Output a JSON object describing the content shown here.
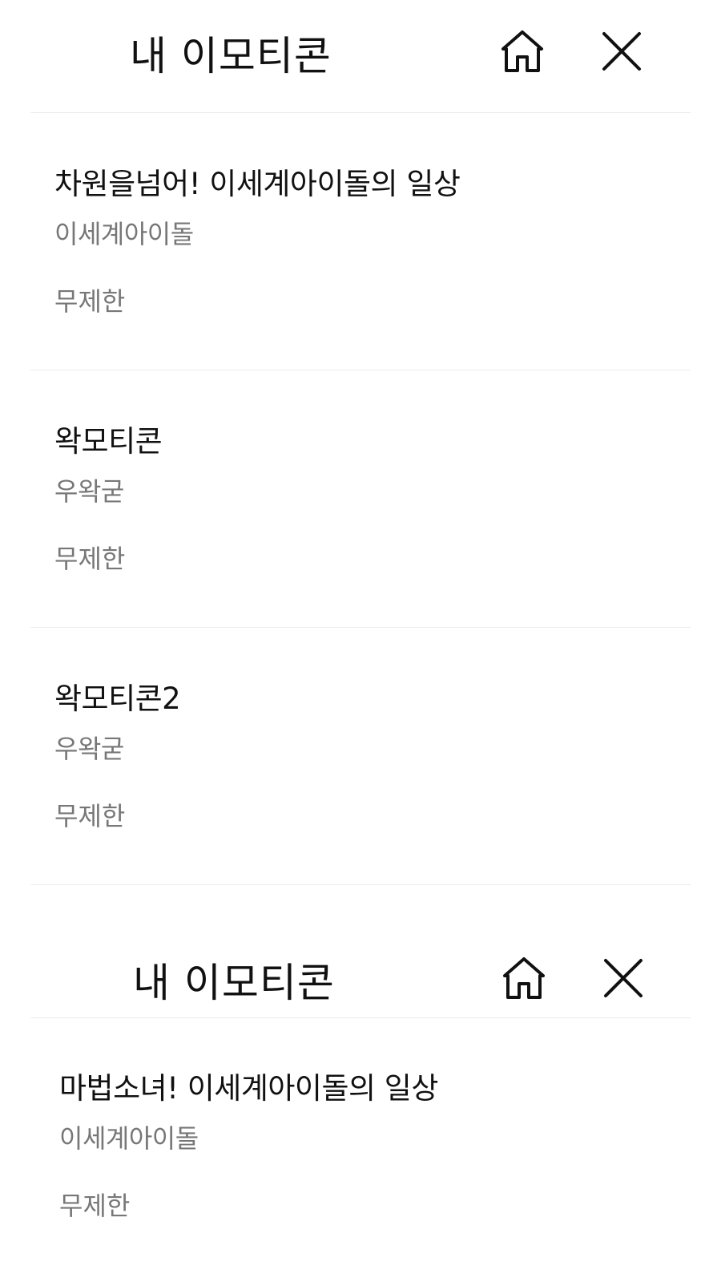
{
  "header": {
    "title": "내 이모티콘",
    "home_icon": "home-icon",
    "close_icon": "close-icon"
  },
  "emoticons": [
    {
      "title": "차원을넘어! 이세계아이돌의 일상",
      "author": "이세계아이돌",
      "period": "무제한"
    },
    {
      "title": "왁모티콘",
      "author": "우왁굳",
      "period": "무제한"
    },
    {
      "title": "왁모티콘2",
      "author": "우왁굳",
      "period": "무제한"
    },
    {
      "title": "마법소녀! 이세계아이돌의 일상",
      "author": "이세계아이돌",
      "period": "무제한"
    }
  ],
  "colors": {
    "text_primary": "#111111",
    "text_secondary": "#777777",
    "divider": "#ececec",
    "background": "#ffffff"
  }
}
